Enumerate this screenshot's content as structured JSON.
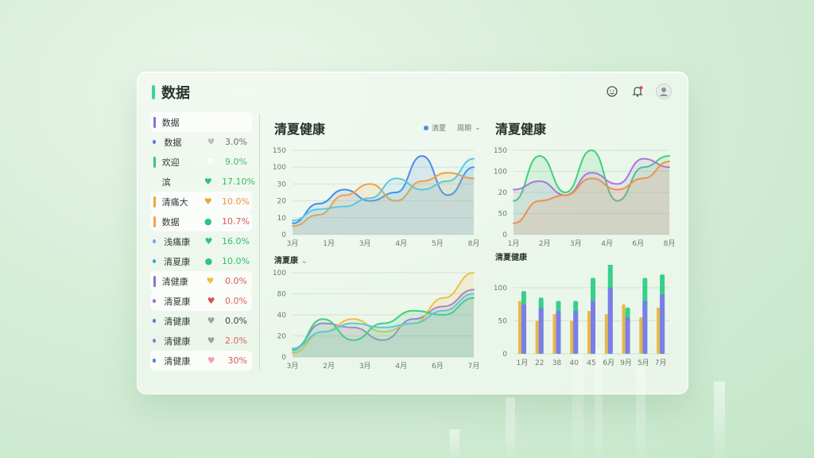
{
  "app": {
    "title": "数据"
  },
  "header_icons": [
    "smile-icon",
    "bell-icon",
    "avatar"
  ],
  "sidebar": {
    "items": [
      {
        "label": "数据",
        "marker": "bar",
        "color": "#8b6fd6",
        "heart": "",
        "heart_color": "#999",
        "value": "",
        "value_color": "#555",
        "highlight": true
      },
      {
        "label": "数据",
        "marker": "dot",
        "color": "#4b7fe0",
        "heart": "♥",
        "heart_color": "#b7c2bb",
        "value": "3.0%",
        "value_color": "#6b6f6c",
        "highlight": false
      },
      {
        "label": "欢迎",
        "marker": "bar",
        "color": "#38c97a",
        "heart": "♥",
        "heart_color": "#ffffff",
        "value": "9.0%",
        "value_color": "#3fbf6e",
        "highlight": false
      },
      {
        "label": "滨",
        "marker": "none",
        "color": "#38c97a",
        "heart": "♥",
        "heart_color": "#2fc47a",
        "value": "17.10%",
        "value_color": "#2fbf6a",
        "highlight": false
      },
      {
        "label": "清痛大",
        "marker": "bar",
        "color": "#f2a440",
        "heart": "♥",
        "heart_color": "#f0a640",
        "value": "10.0%",
        "value_color": "#e89a38",
        "highlight": true
      },
      {
        "label": "数据",
        "marker": "bar",
        "color": "#f2a440",
        "heart": "●",
        "heart_color": "#2fc47a",
        "value": "10.7%",
        "value_color": "#e05858",
        "highlight": true
      },
      {
        "label": "浅痛康",
        "marker": "dot",
        "color": "#6aa8f0",
        "heart": "♥",
        "heart_color": "#2fc47a",
        "value": "16.0%",
        "value_color": "#2fbf6a",
        "highlight": false
      },
      {
        "label": "清夏康",
        "marker": "dot",
        "color": "#35a8d8",
        "heart": "●",
        "heart_color": "#2fc47a",
        "value": "10.0%",
        "value_color": "#2fbf6a",
        "highlight": false
      },
      {
        "label": "清健康",
        "marker": "bar",
        "color": "#8b6fd6",
        "heart": "♥",
        "heart_color": "#f0c040",
        "value": "0.0%",
        "value_color": "#e05858",
        "highlight": true
      },
      {
        "label": "清夏康",
        "marker": "dot",
        "color": "#b06ad0",
        "heart": "♥",
        "heart_color": "#e05050",
        "value": "0.0%",
        "value_color": "#e06060",
        "highlight": true
      },
      {
        "label": "清健康",
        "marker": "dot",
        "color": "#4b7fe0",
        "heart": "♥",
        "heart_color": "#9aa59e",
        "value": "0.0%",
        "value_color": "#3a4540",
        "highlight": false
      },
      {
        "label": "清健康",
        "marker": "dot",
        "color": "#b06ad0",
        "heart": "♥",
        "heart_color": "#9aa59e",
        "value": "2.0%",
        "value_color": "#e06060",
        "highlight": false
      },
      {
        "label": "清健康",
        "marker": "dot",
        "color": "#4b7fe0",
        "heart": "♥",
        "heart_color": "#f0a0b0",
        "value": "30%",
        "value_color": "#e05858",
        "highlight": true
      }
    ]
  },
  "chart1": {
    "title": "清夏健康",
    "legend_a": "清夏",
    "legend_b": "周期"
  },
  "chart2": {
    "title": "清夏健康"
  },
  "chart3": {
    "title": "清夏康"
  },
  "chart4": {
    "title": "清夏健康"
  },
  "chart_data": [
    {
      "type": "line",
      "x": [
        "3月",
        "1月",
        "3月",
        "4月",
        "5月",
        "8月"
      ],
      "yticks": [
        "0",
        "10",
        "20",
        "30",
        "100",
        "150"
      ],
      "ylim": [
        0,
        150
      ],
      "series": [
        {
          "values": [
            20,
            55,
            80,
            60,
            75,
            140,
            70,
            120
          ],
          "color": "#4a8be8"
        },
        {
          "values": [
            15,
            35,
            70,
            90,
            60,
            95,
            110,
            100
          ],
          "color": "#f0a044"
        },
        {
          "values": [
            25,
            45,
            50,
            65,
            100,
            80,
            95,
            135
          ],
          "color": "#5cc8e0"
        }
      ]
    },
    {
      "type": "line",
      "x": [
        "1月",
        "2月",
        "3月",
        "4月",
        "6月",
        "8月"
      ],
      "yticks": [
        "0",
        "50",
        "20",
        "100",
        "150"
      ],
      "ylim": [
        0,
        150
      ],
      "series": [
        {
          "values": [
            60,
            140,
            75,
            150,
            60,
            120,
            140
          ],
          "color": "#3fd07a"
        },
        {
          "values": [
            80,
            95,
            70,
            110,
            90,
            135,
            120
          ],
          "color": "#a879d8"
        },
        {
          "values": [
            20,
            60,
            70,
            100,
            80,
            100,
            130
          ],
          "color": "#f0904a"
        }
      ]
    },
    {
      "type": "line",
      "x": [
        "3月",
        "2月",
        "3月",
        "4月",
        "6月",
        "7月"
      ],
      "yticks": [
        "0",
        "20",
        "40",
        "80",
        "100"
      ],
      "ylim": [
        0,
        100
      ],
      "series": [
        {
          "values": [
            10,
            40,
            35,
            20,
            45,
            60,
            80
          ],
          "color": "#a879d8"
        },
        {
          "values": [
            5,
            30,
            45,
            30,
            40,
            70,
            100
          ],
          "color": "#f0c040"
        },
        {
          "values": [
            8,
            45,
            20,
            40,
            55,
            50,
            70
          ],
          "color": "#3fd07a"
        },
        {
          "values": [
            10,
            30,
            40,
            35,
            40,
            55,
            75
          ],
          "color": "#5cc8e0"
        }
      ]
    },
    {
      "type": "bar",
      "categories": [
        "1月",
        "22",
        "38",
        "40",
        "45",
        "6月",
        "9月",
        "5月",
        "7月"
      ],
      "yticks": [
        "0",
        "50",
        "100"
      ],
      "ylim": [
        0,
        130
      ],
      "series": [
        {
          "values": [
            80,
            50,
            60,
            50,
            65,
            60,
            75,
            55,
            70
          ],
          "color": "#e8b848"
        },
        {
          "values": [
            95,
            85,
            80,
            80,
            115,
            140,
            70,
            115,
            120
          ],
          "color": "#36d08a"
        },
        {
          "values": [
            75,
            70,
            65,
            65,
            80,
            100,
            55,
            80,
            90
          ],
          "color": "#7a7ee8"
        }
      ]
    }
  ]
}
